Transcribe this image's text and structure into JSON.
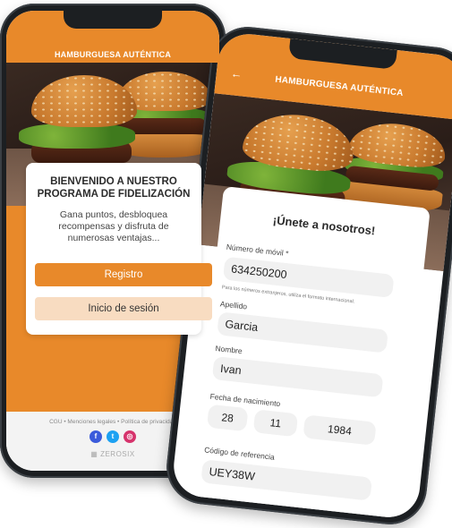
{
  "left_phone": {
    "header": {
      "title": "HAMBURGUESA AUTÉNTICA"
    },
    "welcome": {
      "title_line1": "BIENVENIDO A NUESTRO",
      "title_line2": "PROGRAMA DE FIDELIZACIÓN",
      "subtitle": "Gana puntos, desbloquea recompensas y disfruta de numerosas ventajas..."
    },
    "buttons": {
      "register": "Registro",
      "login": "Inicio de sesión"
    },
    "footer": {
      "links": "CGU • Menciones legales • Política de privacidad",
      "brand": "ZEROSIX",
      "socials": {
        "facebook_icon": "f",
        "twitter_icon": "t",
        "instagram_icon": "◎"
      }
    }
  },
  "right_phone": {
    "header": {
      "title": "HAMBURGUESA AUTÉNTICA",
      "back_icon": "←"
    },
    "form": {
      "title": "¡Únete a nosotros!",
      "mobile_label": "Número de móvil *",
      "mobile_value": "634250200",
      "mobile_hint": "Para los números extranjeros, utiliza el formato internacional.",
      "surname_label": "Apellido",
      "surname_value": "Garcia",
      "name_label": "Nombre",
      "name_value": "Ivan",
      "birthdate_label": "Fecha de nacimiento",
      "birth_day": "28",
      "birth_month": "11",
      "birth_year": "1984",
      "referral_label": "Código de referencia",
      "referral_value": "UEY38W"
    }
  },
  "colors": {
    "accent": "#e8892a",
    "accent_light": "#f8dcc1"
  }
}
